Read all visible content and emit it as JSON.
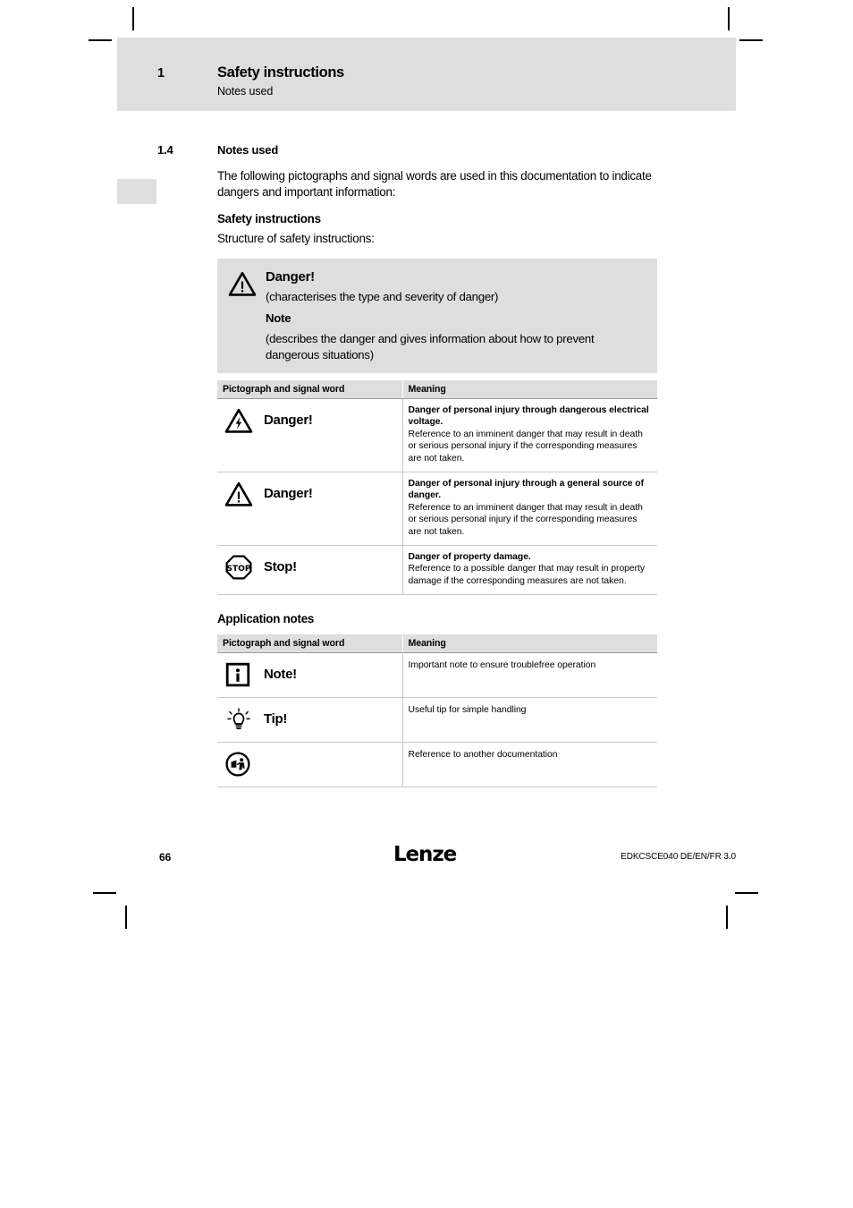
{
  "header": {
    "chapter_number": "1",
    "title": "Safety instructions",
    "subtitle": "Notes used"
  },
  "section": {
    "number": "1.4",
    "title": "Notes used",
    "intro": "The following pictographs and signal words are used in this documentation to indicate dangers and important information:",
    "safety_heading": "Safety instructions",
    "safety_subtext": "Structure of safety instructions:"
  },
  "callout": {
    "icon": "warning-triangle-icon",
    "signal_word": "Danger!",
    "description": "(characterises the type and severity of danger)",
    "note_label": "Note",
    "note_text": "(describes the danger and gives information about how to prevent dangerous situations)"
  },
  "safety_table": {
    "columns": [
      "Pictograph and signal word",
      "Meaning"
    ],
    "rows": [
      {
        "icon": "high-voltage-triangle-icon",
        "signal_word": "Danger!",
        "meaning_title": "Danger of personal injury through dangerous electrical voltage.",
        "meaning_text": "Reference to an imminent danger that may result in death or serious personal injury if the corresponding measures are not taken."
      },
      {
        "icon": "warning-triangle-icon",
        "signal_word": "Danger!",
        "meaning_title": "Danger of personal injury through a general source of danger.",
        "meaning_text": "Reference to an imminent danger that may result in death or serious personal injury if the corresponding measures are not taken."
      },
      {
        "icon": "stop-octagon-icon",
        "signal_word": "Stop!",
        "meaning_title": "Danger of property damage.",
        "meaning_text": "Reference to a possible danger that may result in property damage if the corresponding measures are not taken."
      }
    ]
  },
  "application_notes": {
    "heading": "Application notes",
    "columns": [
      "Pictograph and signal word",
      "Meaning"
    ],
    "rows": [
      {
        "icon": "info-square-icon",
        "signal_word": "Note!",
        "meaning_text": "Important note to ensure troublefree operation"
      },
      {
        "icon": "lightbulb-icon",
        "signal_word": "Tip!",
        "meaning_text": "Useful tip for simple handling"
      },
      {
        "icon": "read-documentation-icon",
        "signal_word": "",
        "meaning_text": "Reference to another documentation"
      }
    ]
  },
  "footer": {
    "page_number": "66",
    "logo_text": "Lenze",
    "document_id": "EDKCSCE040 DE/EN/FR 3.0"
  },
  "colors": {
    "band_gray": "#dedede",
    "rule_gray": "#c9c9c9",
    "text": "#000000"
  }
}
